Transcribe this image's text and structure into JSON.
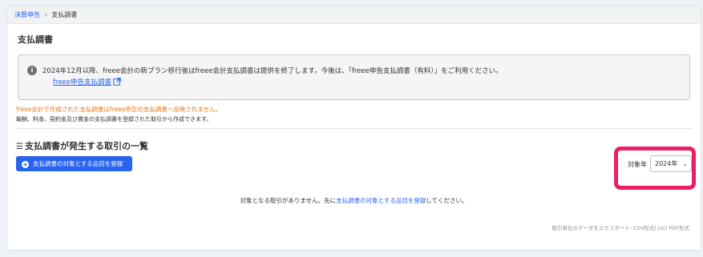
{
  "breadcrumb": {
    "parent": "決算申告",
    "separator": "»",
    "current": "支払調書"
  },
  "page": {
    "title": "支払調書"
  },
  "notice": {
    "icon": "info-icon",
    "text": "2024年12月以降、freee会計の新プラン移行後はfreee会計支払調書は提供を終了します。今後は、「freee申告支払調書（有料）」をご利用ください。",
    "link_text": "freee申告支払調書"
  },
  "warning_text": "freee会計で作成された支払調書はfreee申告の支払調書へ反映されません。",
  "description": "報酬、料金、契約金及び賞金の支払調書を登録された取引から作成できます。",
  "section": {
    "heading": "支払調書が発生する取引の一覧"
  },
  "add_button": {
    "label": "支払調書の対象とする品目を登録"
  },
  "year_filter": {
    "label": "対象年",
    "selected": "2024年",
    "highlight_color": "#ed1e63"
  },
  "empty_message": {
    "before": "対象となる取引がありません。先に",
    "link": "支払調書の対象とする品目を登録",
    "after": "してください。"
  },
  "export": {
    "text": "取引単位のデータをエクスポート: CSV形式(.txt) PDF形式"
  },
  "colors": {
    "accent": "#2864f0",
    "warning": "#e8781e"
  }
}
